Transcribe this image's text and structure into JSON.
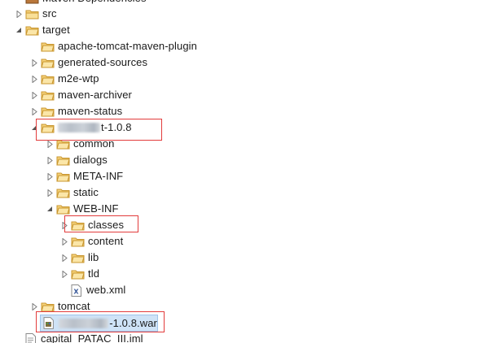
{
  "tree": {
    "partial_top": "Maven Dependencies",
    "src": "src",
    "target": "target",
    "plugin": "apache-tomcat-maven-plugin",
    "generated": "generated-sources",
    "m2e": "m2e-wtp",
    "archiver": "maven-archiver",
    "status": "maven-status",
    "webapp_suffix": "t-1.0.8",
    "common": "common",
    "dialogs": "dialogs",
    "meta_inf": "META-INF",
    "static": "static",
    "web_inf": "WEB-INF",
    "classes": "classes",
    "content": "content",
    "lib": "lib",
    "tld": "tld",
    "webxml": "web.xml",
    "tomcat": "tomcat",
    "war_suffix": "-1.0.8.war",
    "iml": "capital_PATAC_III.iml"
  },
  "colors": {
    "folder": "#e8b64a",
    "highlight": "#e23c3c",
    "selection": "#cfe3f7"
  }
}
